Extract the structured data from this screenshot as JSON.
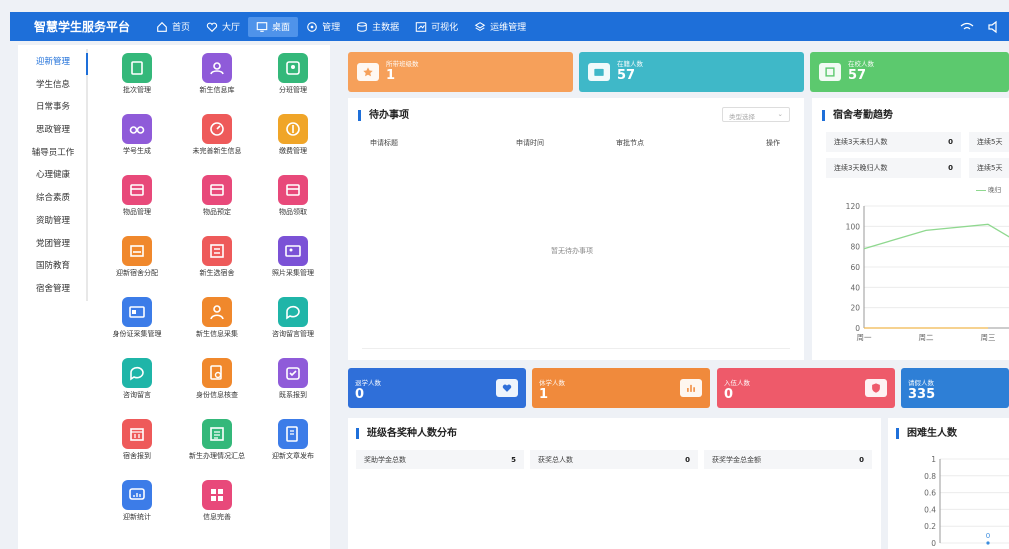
{
  "header": {
    "title": "智慧学生服务平台",
    "nav": [
      {
        "label": "首页",
        "icon": "home-icon"
      },
      {
        "label": "大厅",
        "icon": "heart-icon"
      },
      {
        "label": "桌面",
        "icon": "desktop-icon",
        "active": true
      },
      {
        "label": "管理",
        "icon": "settings-icon"
      },
      {
        "label": "主数据",
        "icon": "database-icon"
      },
      {
        "label": "可视化",
        "icon": "chart-icon"
      },
      {
        "label": "运维管理",
        "icon": "layers-icon"
      }
    ]
  },
  "sidebar": {
    "items": [
      {
        "label": "迎新管理",
        "active": true
      },
      {
        "label": "学生信息"
      },
      {
        "label": "日常事务"
      },
      {
        "label": "思政管理"
      },
      {
        "label": "辅导员工作"
      },
      {
        "label": "心理健康"
      },
      {
        "label": "综合素质"
      },
      {
        "label": "资助管理"
      },
      {
        "label": "党团管理"
      },
      {
        "label": "国防教育"
      },
      {
        "label": "宿舍管理"
      }
    ]
  },
  "tiles": [
    {
      "label": "批次管理",
      "color": "#34b87a",
      "icon": "doc-icon"
    },
    {
      "label": "新生信息库",
      "color": "#8f5bd9",
      "icon": "people-icon"
    },
    {
      "label": "分班管理",
      "color": "#34b87a",
      "icon": "user-card-icon"
    },
    {
      "label": "学号生成",
      "color": "#8f5bd9",
      "icon": "glasses-icon"
    },
    {
      "label": "未完善新生信息",
      "color": "#ee5a5a",
      "icon": "gauge-icon"
    },
    {
      "label": "缴费管理",
      "color": "#f0a528",
      "icon": "coin-icon"
    },
    {
      "label": "物品管理",
      "color": "#e8497a",
      "icon": "box-icon"
    },
    {
      "label": "物品预定",
      "color": "#e8497a",
      "icon": "box-icon"
    },
    {
      "label": "物品领取",
      "color": "#e8497a",
      "icon": "box-icon"
    },
    {
      "label": "迎新宿舍分配",
      "color": "#f0882c",
      "icon": "bed-icon"
    },
    {
      "label": "新生选宿舍",
      "color": "#ee5a5a",
      "icon": "building-icon"
    },
    {
      "label": "照片采集管理",
      "color": "#7b52d6",
      "icon": "image-icon"
    },
    {
      "label": "身份证采集管理",
      "color": "#3c7ce8",
      "icon": "id-card-icon"
    },
    {
      "label": "新生信息采集",
      "color": "#f0882c",
      "icon": "user-icon"
    },
    {
      "label": "咨询留言管理",
      "color": "#1fb5a8",
      "icon": "chat-icon"
    },
    {
      "label": "咨询留言",
      "color": "#1fb5a8",
      "icon": "chat-icon"
    },
    {
      "label": "身份信息核查",
      "color": "#f0882c",
      "icon": "search-doc-icon"
    },
    {
      "label": "既系报到",
      "color": "#8f5bd9",
      "icon": "checkin-icon"
    },
    {
      "label": "宿舍报到",
      "color": "#ee5a5a",
      "icon": "calendar-icon"
    },
    {
      "label": "新生办理情况汇总",
      "color": "#34b87a",
      "icon": "list-icon"
    },
    {
      "label": "迎新文章发布",
      "color": "#3c7ce8",
      "icon": "article-icon"
    },
    {
      "label": "迎新统计",
      "color": "#3c7ce8",
      "icon": "monitor-icon"
    },
    {
      "label": "信息完善",
      "color": "#e8497a",
      "icon": "grid-icon"
    }
  ],
  "stats_top": [
    {
      "label": "所带班级数",
      "value": "1",
      "color": "#f6a05a",
      "icon": "star-icon"
    },
    {
      "label": "在籍人数",
      "value": "57",
      "color": "#3fb8c8",
      "icon": "card-icon"
    },
    {
      "label": "在校人数",
      "value": "57",
      "color": "#5cc96e",
      "icon": "calendar-icon"
    }
  ],
  "todo": {
    "title": "待办事项",
    "select_placeholder": "类型选择",
    "headers": [
      "申请标题",
      "申请时间",
      "审批节点",
      "操作"
    ],
    "empty": "暂无待办事项"
  },
  "attendance": {
    "title": "宿舍考勤趋势",
    "items": [
      {
        "label": "连续3天未归人数",
        "value": "0"
      },
      {
        "label": "连续5天",
        "value": ""
      },
      {
        "label": "连续3天晚归人数",
        "value": "0"
      },
      {
        "label": "连续5天",
        "value": ""
      }
    ],
    "legend": "晚归"
  },
  "chart_data": [
    {
      "type": "line",
      "title": "宿舍考勤趋势",
      "x": [
        "周一",
        "周二",
        "周三"
      ],
      "yticks": [
        0,
        20,
        40,
        60,
        80,
        100,
        120
      ],
      "ylim": [
        0,
        120
      ],
      "series": [
        {
          "name": "晚归",
          "color": "#8fd88f",
          "values": [
            78,
            96,
            102
          ]
        },
        {
          "color": "#f0b64d",
          "values": [
            0,
            0,
            0
          ]
        }
      ]
    },
    {
      "type": "line",
      "title": "困难生人数",
      "yticks": [
        0,
        0.2,
        0.4,
        0.6,
        0.8,
        1
      ],
      "ylim": [
        0,
        1
      ],
      "series": [
        {
          "values": [
            0
          ]
        }
      ]
    }
  ],
  "stats_mid": [
    {
      "label": "退学人数",
      "value": "0",
      "color": "#2f6fd9",
      "icon": "heart-hand-icon"
    },
    {
      "label": "休学人数",
      "value": "1",
      "color": "#f08a3c",
      "icon": "bar-icon"
    },
    {
      "label": "入伍人数",
      "value": "0",
      "color": "#ee5a6a",
      "icon": "shield-icon"
    },
    {
      "label": "请假人数",
      "value": "335",
      "color": "#2e7fd6",
      "icon": ""
    }
  ],
  "awards": {
    "title": "班级各奖种人数分布",
    "items": [
      {
        "label": "奖助学金总数",
        "value": "5"
      },
      {
        "label": "获奖总人数",
        "value": "0"
      },
      {
        "label": "获奖学金总金额",
        "value": "0"
      }
    ]
  },
  "difficult": {
    "title": "困难生人数"
  }
}
